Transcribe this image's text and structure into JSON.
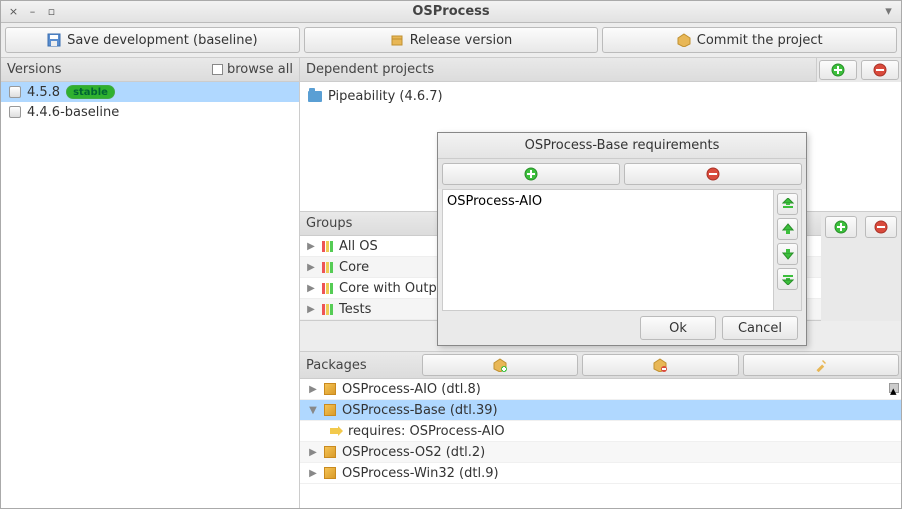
{
  "window": {
    "title": "OSProcess"
  },
  "toolbar": {
    "save_label": "Save development (baseline)",
    "release_label": "Release version",
    "commit_label": "Commit the project"
  },
  "sidebar": {
    "header": "Versions",
    "browse_all_label": "browse all",
    "items": [
      {
        "version": "4.5.8",
        "badge": "stable",
        "selected": true
      },
      {
        "version": "4.4.6-baseline",
        "badge": null,
        "selected": false
      }
    ]
  },
  "dependent": {
    "header": "Dependent projects",
    "items": [
      {
        "label": "Pipeability (4.6.7)"
      }
    ]
  },
  "groups": {
    "header": "Groups",
    "items": [
      {
        "label": "All OS"
      },
      {
        "label": "Core"
      },
      {
        "label": "Core with Outp"
      },
      {
        "label": "Tests"
      }
    ]
  },
  "packages": {
    "header": "Packages",
    "items": [
      {
        "label": "OSProcess-AIO (dtl.8)",
        "selected": false,
        "expanded": false,
        "alt": false
      },
      {
        "label": "OSProcess-Base (dtl.39)",
        "selected": true,
        "expanded": true,
        "alt": true
      },
      {
        "label": "requires: OSProcess-AIO",
        "child": true
      },
      {
        "label": "OSProcess-OS2 (dtl.2)",
        "selected": false,
        "expanded": false,
        "alt": true
      },
      {
        "label": "OSProcess-Win32 (dtl.9)",
        "selected": false,
        "expanded": false,
        "alt": false
      }
    ]
  },
  "dialog": {
    "title": "OSProcess-Base requirements",
    "list": [
      "OSProcess-AIO"
    ],
    "ok_label": "Ok",
    "cancel_label": "Cancel"
  },
  "colors": {
    "selection": "#b0d8ff",
    "add": "#2fb12f",
    "remove": "#d94a3c"
  }
}
